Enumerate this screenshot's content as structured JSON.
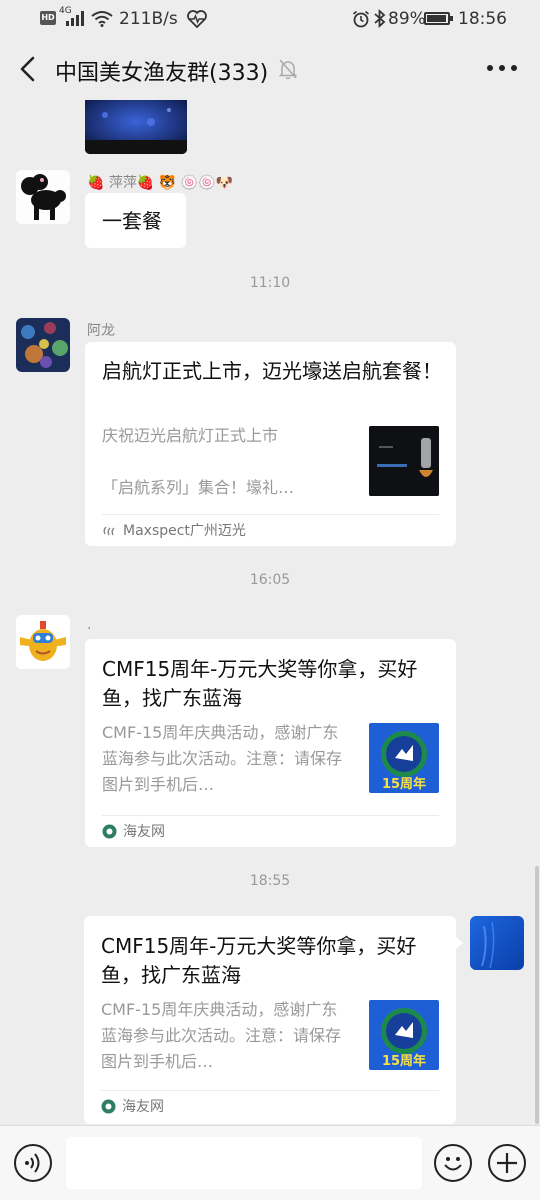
{
  "status_bar": {
    "hd": "HD",
    "network": "4G",
    "speed": "211B/s",
    "battery": "89%",
    "time": "18:56"
  },
  "nav": {
    "title": "中国美女渔友群(333)"
  },
  "messages": {
    "m1": {
      "sender": "🍓 萍萍🍓 🐯 🍥🍥🐶",
      "text": "一套餐"
    },
    "t1": "11:10",
    "m2": {
      "sender": "阿龙",
      "title": "启航灯正式上市，迈光壕送启航套餐！",
      "desc": "庆祝迈光启航灯正式上市\n\n「启航系列」集合！壕礼…",
      "source": "Maxspect广州迈光"
    },
    "t2": "16:05",
    "m3": {
      "sender": ".",
      "title": "CMF15周年-万元大奖等你拿，买好鱼，找广东蓝海",
      "desc": "CMF-15周年庆典活动，感谢广东蓝海参与此次活动。注意：请保存图片到手机后…",
      "source": "海友网",
      "thumb_label": "15周年"
    },
    "t3": "18:55",
    "m4": {
      "title": "CMF15周年-万元大奖等你拿，买好鱼，找广东蓝海",
      "desc": "CMF-15周年庆典活动，感谢广东蓝海参与此次活动。注意：请保存图片到手机后…",
      "source": "海友网",
      "thumb_label": "15周年"
    }
  },
  "input": {
    "placeholder": ""
  },
  "colors": {
    "background": "#ededed",
    "bubble": "#ffffff",
    "meta_text": "#999999",
    "accent_blue": "#1f5fd6"
  }
}
